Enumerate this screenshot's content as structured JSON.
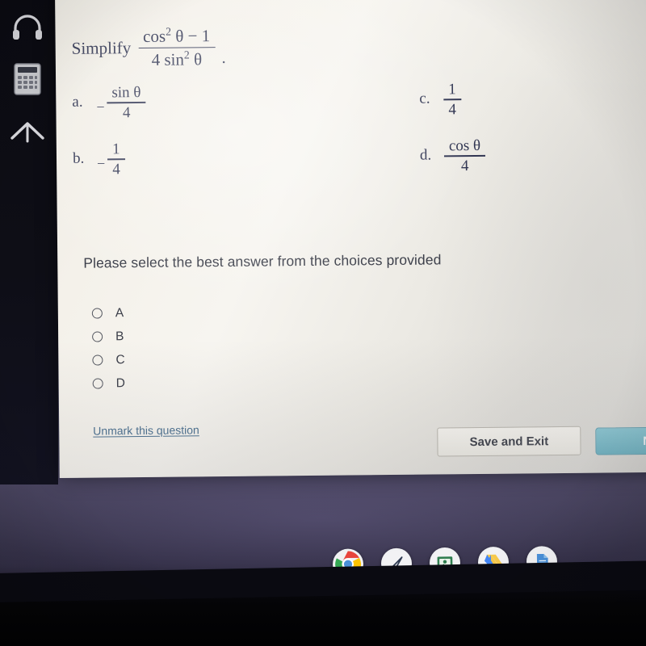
{
  "quiz": {
    "question": {
      "prompt": "Simplify",
      "numerator_base": "cos",
      "numerator_exponent": "2",
      "numerator_var": "θ",
      "numerator_tail": "− 1",
      "denominator_coeff": "4 sin",
      "denominator_exponent": "2",
      "denominator_var": "θ",
      "trailing_period": "."
    },
    "choices": [
      {
        "key": "a.",
        "sign": "−",
        "numerator": "sin θ",
        "denominator": "4"
      },
      {
        "key": "b.",
        "sign": "−",
        "numerator": "1",
        "denominator": "4"
      },
      {
        "key": "c.",
        "sign": "",
        "numerator": "1",
        "denominator": "4"
      },
      {
        "key": "d.",
        "sign": "",
        "numerator": "cos θ",
        "denominator": "4"
      }
    ],
    "instruction": "Please select the best answer from the choices provided",
    "radio_options": [
      {
        "label": "A",
        "selected": false
      },
      {
        "label": "B",
        "selected": false
      },
      {
        "label": "C",
        "selected": false
      },
      {
        "label": "D",
        "selected": false
      }
    ],
    "footer": {
      "unmark_link": "Unmark this question",
      "save_button": "Save and Exit",
      "next_button": "Next"
    }
  },
  "tool_rail": {
    "items": [
      {
        "icon": "headphones-icon",
        "name": "audio-tool"
      },
      {
        "icon": "calculator-icon",
        "name": "calculator-tool"
      },
      {
        "icon": "arrow-up-icon",
        "name": "scroll-up-tool"
      }
    ]
  },
  "taskbar": {
    "items": [
      {
        "icon": "chrome-icon",
        "name": "chrome"
      },
      {
        "icon": "stylus-icon",
        "name": "stylus"
      },
      {
        "icon": "slides-icon",
        "name": "slides"
      },
      {
        "icon": "drive-icon",
        "name": "drive"
      },
      {
        "icon": "docs-icon",
        "name": "docs"
      }
    ]
  },
  "colors": {
    "ink": "#2e3350",
    "text": "#3c3f4a",
    "link": "#4a6f8f",
    "next_button": "#6ab2c2",
    "page": "#f4f1ea"
  }
}
